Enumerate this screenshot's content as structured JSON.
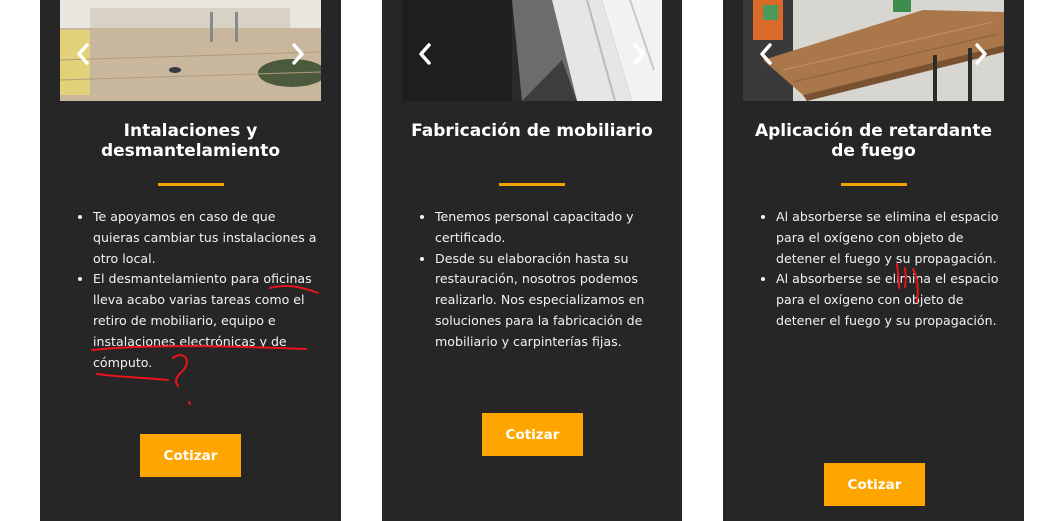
{
  "cards": [
    {
      "title": "Intalaciones y desmantelamiento",
      "bullets": [
        "Te apoyamos en caso de que quieras cambiar tus instalaciones a otro local.",
        "El desmantelamiento para oficinas lleva acabo varias tareas como el retiro de mobiliario, equipo e instalaciones electrónicas y de cómputo."
      ],
      "button": "Cotizar"
    },
    {
      "title": "Fabricación de mobiliario",
      "bullets": [
        "Tenemos personal capacitado y certificado.",
        "Desde su elaboración hasta su restauración, nosotros podemos realizarlo. Nos especializamos en soluciones para la fabricación de mobiliario y carpinterías fijas."
      ],
      "button": "Cotizar"
    },
    {
      "title": "Aplicación de retardante de fuego",
      "bullets": [
        "Al absorberse se elimina el espacio para el oxígeno con objeto de detener el fuego y su propagación.",
        "Al absorberse se elimina el espacio para el oxígeno con objeto de detener el fuego y su propagación."
      ],
      "button": "Cotizar"
    }
  ],
  "icons": {
    "prev": "chevron-left-icon",
    "next": "chevron-right-icon"
  },
  "colors": {
    "card_bg": "#262626",
    "accent": "#ffa500",
    "annotation": "#e8141a"
  }
}
